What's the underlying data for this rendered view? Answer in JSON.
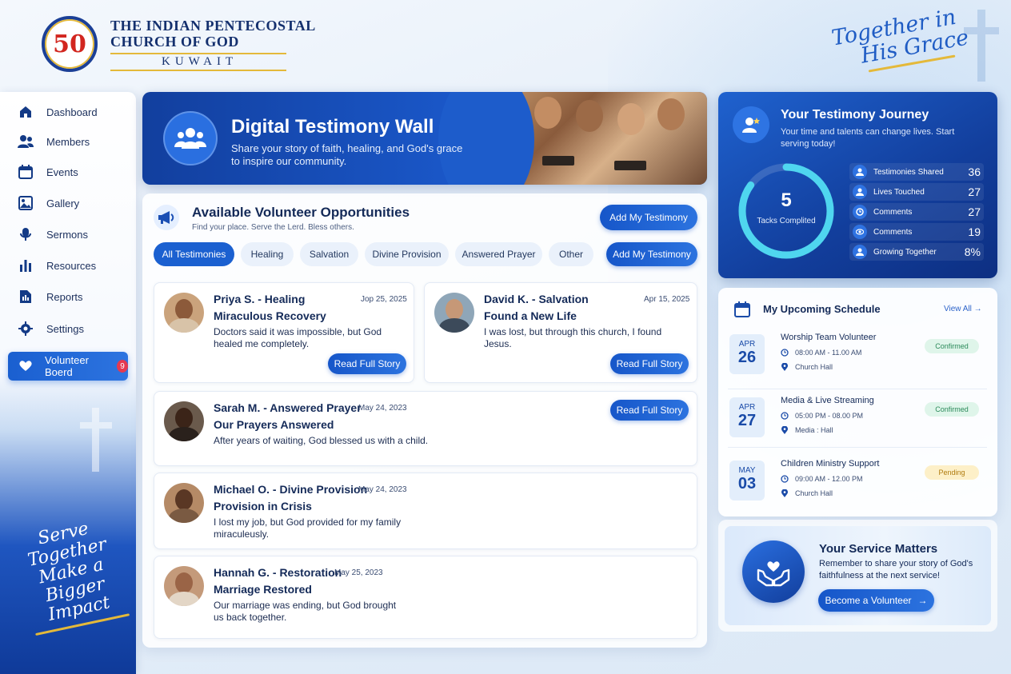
{
  "brand": {
    "logo_mark": "50",
    "line1": "THE INDIAN PENTECOSTAL",
    "line2": "CHURCH OF GOD",
    "line3": "KUWAIT",
    "tagline_line1": "Together in",
    "tagline_line2": "His Grace"
  },
  "sidebar": {
    "items": [
      {
        "label": "Dashboard",
        "icon": "home-icon"
      },
      {
        "label": "Members",
        "icon": "users-icon"
      },
      {
        "label": "Events",
        "icon": "calendar-icon"
      },
      {
        "label": "Gallery",
        "icon": "image-icon"
      },
      {
        "label": "Sermons",
        "icon": "microphone-icon"
      },
      {
        "label": "Resources",
        "icon": "bar-chart-icon"
      },
      {
        "label": "Reports",
        "icon": "document-icon"
      },
      {
        "label": "Settings",
        "icon": "gear-icon"
      }
    ],
    "active": {
      "label": "Volunteer Boerd",
      "badge": "9",
      "icon": "heart-hands-icon"
    },
    "slogan_line1": "Serve",
    "slogan_line2": "Together",
    "slogan_line3": "Make a Bigger",
    "slogan_line4": "Impact"
  },
  "hero": {
    "title": "Digital Testimony Wall",
    "subtitle": "Share your story of faith, healing, and God's grace to inspire our community."
  },
  "opportunities": {
    "title": "Available Volunteer Opportunities",
    "subtitle": "Find your place. Serve the Lerd. Bless others.",
    "add_button": "Add My Testimony",
    "add_button_2": "Add My Testimony",
    "filters": [
      "All Testimonies",
      "Healing",
      "Salvation",
      "Divine Provision",
      "Answered Prayer",
      "Other"
    ],
    "active_filter": "All Testimonies"
  },
  "testimonies": [
    {
      "name": "Priya S. - Healing",
      "date": "Jop 25, 2025",
      "headline": "Miraculous Recovery",
      "body": "Doctors said it was impossible, but God healed me completely.",
      "button": "Read Full Story"
    },
    {
      "name": "David K. - Salvation",
      "date": "Apr 15, 2025",
      "headline": "Found a New Life",
      "body": "I was lost, but through this church, I found Jesus.",
      "button": "Read Full Story"
    },
    {
      "name": "Sarah M. - Answered Prayer",
      "date": "May 24, 2023",
      "headline": "Our Prayers Answered",
      "body": "After years of waiting, God blessed us with a child.",
      "button": "Read Full Story"
    },
    {
      "name": "Michael O. - Divine Provision",
      "date": "May 24, 2023",
      "headline": "Provision in Crisis",
      "body": "I lost my job, but God provided for my family miraculeusly."
    },
    {
      "name": "Hannah G. - Restoration",
      "date": "May 25, 2023",
      "headline": "Marriage Restored",
      "body": "Our marriage was ending, but God brought us back together."
    }
  ],
  "journey": {
    "title": "Your Testimony Journey",
    "subtitle": "Your time and talents can change lives. Start serving today!",
    "ring_value": "5",
    "ring_label": "Tacks Complited",
    "ring_progress": 0.85,
    "stats": [
      {
        "label": "Testimonies Shared",
        "value": "36",
        "icon": "person-icon"
      },
      {
        "label": "Lives Touched",
        "value": "27",
        "icon": "person-icon"
      },
      {
        "label": "Comments",
        "value": "27",
        "icon": "clock-icon"
      },
      {
        "label": "Comments",
        "value": "19",
        "icon": "eye-icon"
      },
      {
        "label": "Growing Together",
        "value": "8%",
        "icon": "person-icon"
      }
    ]
  },
  "schedule": {
    "title": "My Upcoming Schedule",
    "view_all": "View All",
    "events": [
      {
        "month": "APR",
        "day": "26",
        "title": "Worship Team Volunteer",
        "time": "08:00 AM - 11.00 AM",
        "place": "Church Hall",
        "status": "Confirmed"
      },
      {
        "month": "APR",
        "day": "27",
        "title": "Media & Live Streaming",
        "time": "05:00 PM - 08.00 PM",
        "place": "Media : Hall",
        "status": "Confirmed"
      },
      {
        "month": "MAY",
        "day": "03",
        "title": "Children Ministry Support",
        "time": "09:00 AM - 12.00 PM",
        "place": "Church Hall",
        "status": "Pending"
      }
    ]
  },
  "service": {
    "title": "Your Service Matters",
    "text": "Remember to share your story of God's faithfulness at the next service!",
    "button": "Become a Volunteer"
  },
  "colors": {
    "primary": "#1b60d0",
    "navy": "#123e9c",
    "accent_gold": "#e4b93a",
    "confirmed": "#2b8a5a",
    "pending": "#b07b0e"
  }
}
